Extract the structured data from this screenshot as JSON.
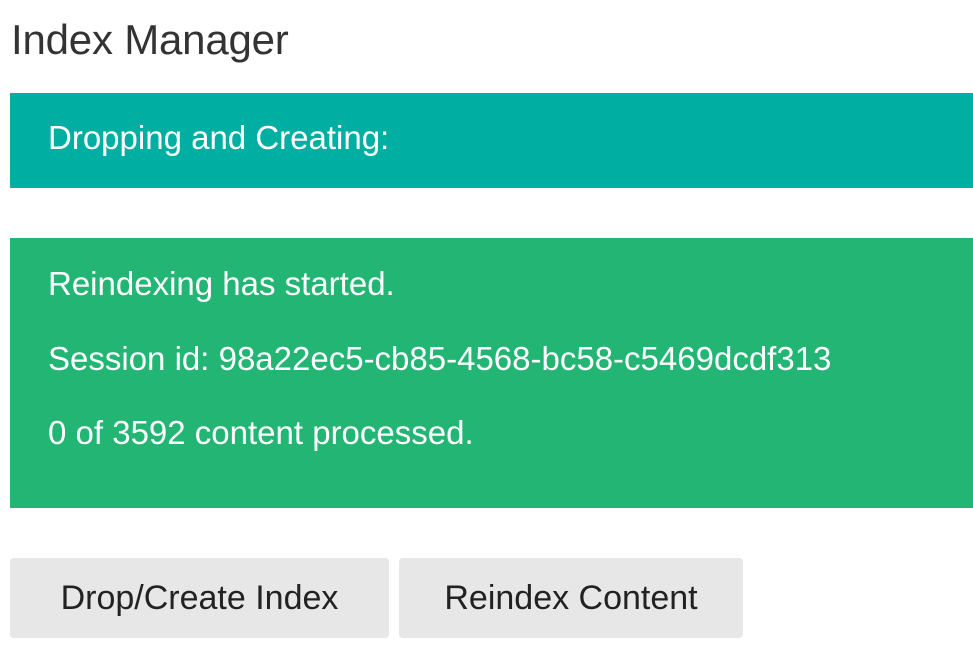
{
  "page": {
    "title": "Index Manager"
  },
  "status": {
    "header": "Dropping and Creating:",
    "color": "#00afa2"
  },
  "progress": {
    "color": "#22b573",
    "message": "Reindexing has started.",
    "session": "Session id: 98a22ec5-cb85-4568-bc58-c5469dcdf313",
    "processed": "0 of 3592 content processed.",
    "processed_count": 0,
    "total_count": 3592
  },
  "actions": {
    "drop_create_label": "Drop/Create Index",
    "reindex_label": "Reindex Content"
  }
}
